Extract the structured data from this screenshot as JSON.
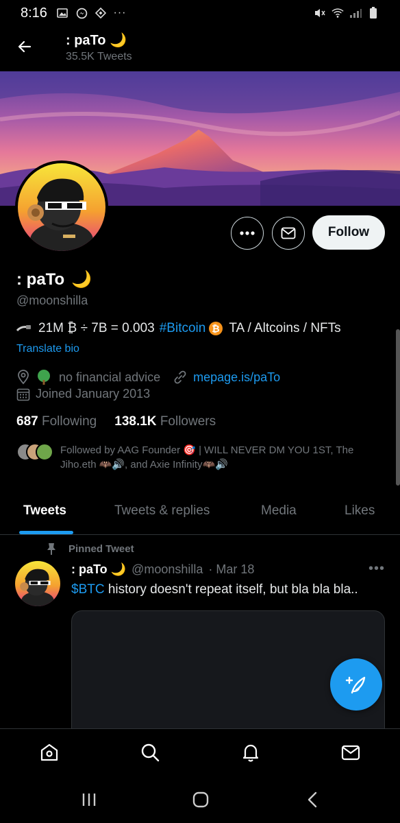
{
  "status_bar": {
    "time": "8:16"
  },
  "header": {
    "title": ": paTo 🌙",
    "subtitle": "35.5K Tweets"
  },
  "profile": {
    "name": ": paTo",
    "name_emoji": "🌙",
    "handle": "@moonshilla",
    "bio_prefix": "21M ₿ ÷ 7B = 0.003",
    "bio_hashtag": "#Bitcoin",
    "bio_suffix": "TA / Altcoins / NFTs",
    "translate_label": "Translate bio",
    "location": "no financial advice",
    "website": "mepage.is/paTo",
    "joined": "Joined January 2013",
    "following_count": "687",
    "following_label": "Following",
    "followers_count": "138.1K",
    "followers_label": "Followers",
    "followed_by_text": "Followed by AAG Founder 🎯 | WILL NEVER DM YOU 1ST, The Jiho.eth 🦇🔊, and Axie Infinity🦇🔊"
  },
  "actions": {
    "follow_label": "Follow"
  },
  "tabs": [
    {
      "label": "Tweets",
      "active": true
    },
    {
      "label": "Tweets & replies",
      "active": false
    },
    {
      "label": "Media",
      "active": false
    },
    {
      "label": "Likes",
      "active": false
    }
  ],
  "pinned_tweet": {
    "pinned_label": "Pinned Tweet",
    "author_name": ": paTo 🌙",
    "author_handle": "@moonshilla",
    "date": "· Mar 18",
    "cashtag": "$BTC",
    "text": " history doesn't repeat itself, but bla bla bla.."
  },
  "colors": {
    "accent": "#1d9bf0",
    "background": "#000000",
    "muted_text": "#71767b"
  },
  "icons": {
    "back": "arrow-left-icon",
    "more": "more-dots-icon",
    "message": "envelope-icon",
    "location": "location-pin-icon",
    "link": "link-icon",
    "calendar": "calendar-icon",
    "compose": "compose-feather-icon",
    "home": "home-icon",
    "search": "search-icon",
    "notifications": "bell-icon",
    "messages": "mail-icon"
  }
}
